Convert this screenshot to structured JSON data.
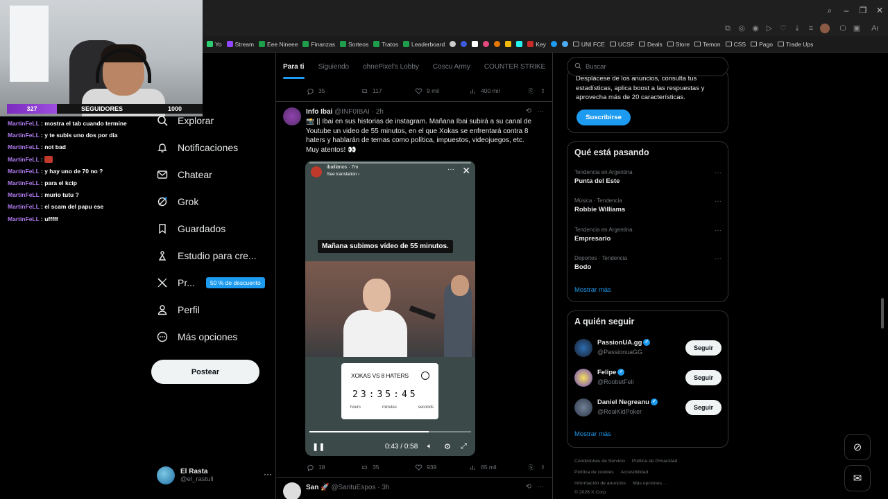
{
  "webcam": {
    "followers_count": "327",
    "followers_label": "SEGUIDORES",
    "followers_goal": "1000",
    "followers_progress": 0.327
  },
  "chat": {
    "messages": [
      {
        "user": "MartinFeLL",
        "text": " : mostra el tab cuando termine"
      },
      {
        "user": "MartinFeLL",
        "text": " : y te subis uno dos por dia"
      },
      {
        "user": "MartinFeLL",
        "text": " : not bad"
      },
      {
        "user": "MartinFeLL",
        "text": " : ",
        "emote": "red-emote"
      },
      {
        "user": "MartinFeLL",
        "text": " : y hay uno de 70 no ?"
      },
      {
        "user": "MartinFeLL",
        "text": " : para el kcip"
      },
      {
        "user": "MartinFeLL",
        "text": " : murio tutu ?"
      },
      {
        "user": "MartinFeLL",
        "text": " : el scam del papu ese"
      },
      {
        "user": "MartinFeLL",
        "text": " : ufffff"
      }
    ]
  },
  "bookmarks": [
    {
      "label": "Yo",
      "icon": "k-icon"
    },
    {
      "label": "Stream",
      "icon": "twitch-icon"
    },
    {
      "label": "Eee Nineee",
      "icon": "sheets-icon"
    },
    {
      "label": "Finanzas",
      "icon": "sheets-icon"
    },
    {
      "label": "Sorteos",
      "icon": "sheets-icon"
    },
    {
      "label": "Tratos",
      "icon": "sheets-icon"
    },
    {
      "label": "Leaderboard",
      "icon": "sheets-icon"
    },
    {
      "label": "Key",
      "icon": "key-icon"
    },
    {
      "label": "UNI FCE",
      "icon": "folder-icon"
    },
    {
      "label": "UCSF",
      "icon": "folder-icon"
    },
    {
      "label": "Deals",
      "icon": "folder-icon"
    },
    {
      "label": "Store",
      "icon": "folder-icon"
    },
    {
      "label": "Temon",
      "icon": "folder-icon"
    },
    {
      "label": "CSS",
      "icon": "folder-icon"
    },
    {
      "label": "Pago",
      "icon": "folder-icon"
    },
    {
      "label": "Trade Ups",
      "icon": "folder-icon"
    }
  ],
  "nav": {
    "explore": "Explorar",
    "notifications": "Notificaciones",
    "chat": "Chatear",
    "grok": "Grok",
    "bookmarks": "Guardados",
    "studio": "Estudio para cre...",
    "premium": "Pr...",
    "premium_badge": "50 % de descuento",
    "profile": "Perfil",
    "more": "Más opciones",
    "post_button": "Postear",
    "account_name": "El Rasta",
    "account_handle": "@el_rastull"
  },
  "feed": {
    "tabs": [
      "Para ti",
      "Siguiendo",
      "ohnePixel's Lobby",
      "Coscu Army",
      "COUNTER STRIKE"
    ],
    "prev_tweet_actions": {
      "replies": "35",
      "reposts": "117",
      "likes": "9 mil",
      "views": "400 mil"
    },
    "tweet": {
      "name": "Info Ibai",
      "handle": "@INF0IBAI",
      "time": "· 2h",
      "text": "📸 || Ibai en sus historias de instagram. Mañana Ibai subirá a su canal de Youtube un video de 55 minutos, en el que Xokas se enfrentará contra 8 haters y hablarán de temas como política, impuestos, videojuegos, etc. Muy atentos! 👀",
      "actions": {
        "replies": "18",
        "reposts": "35",
        "likes": "939",
        "views": "65 mil"
      }
    },
    "video": {
      "story_user": "ibaillanos",
      "story_time": "7m",
      "translate": "See translation ›",
      "caption": "Mañana subimos vídeo de 55 minutos.",
      "timer_title": "XOKAS VS 8 HATERS",
      "timer_digits": "23:35:45",
      "timer_labels": [
        "hours",
        "minutes",
        "seconds"
      ],
      "time": "0:43 / 0:58",
      "progress": 0.74
    },
    "next_tweet": {
      "name": "San 🚀",
      "handle": "@SantuEspos",
      "time": "· 3h"
    }
  },
  "right": {
    "search_placeholder": "Buscar",
    "premium_text": "Desplácese de los anuncios, consulta tus estadísticas, aplica boost a las respuestas y aprovecha más de 20 características.",
    "subscribe": "Suscribirse",
    "trends_title": "Qué está pasando",
    "trends": [
      {
        "category": "Tendencia en Argentina",
        "name": "Punta del Este"
      },
      {
        "category": "Música · Tendencia",
        "name": "Robbie Williams"
      },
      {
        "category": "Tendencia en Argentina",
        "name": "Empresario"
      },
      {
        "category": "Deportes · Tendencia",
        "name": "Bodo"
      }
    ],
    "show_more": "Mostrar más",
    "follow_title": "A quién seguir",
    "follow": [
      {
        "name": "PassionUA.gg",
        "handle": "@PassionuaGG",
        "button": "Seguir"
      },
      {
        "name": "Felipe",
        "handle": "@RoobetFeli",
        "button": "Seguir"
      },
      {
        "name": "Daniel Negreanu",
        "handle": "@RealKidPoker",
        "button": "Seguir"
      }
    ],
    "footer": [
      "Condiciones de Servicio",
      "Política de Privacidad",
      "Política de cookies",
      "Accesibilidad",
      "Información de anuncios",
      "Más opciones ...",
      "© 2026 X Corp."
    ]
  },
  "colors": {
    "accent": "#1d9bf0",
    "background": "#000000",
    "text": "#e7e9ea",
    "muted": "#71767b",
    "chat_user": "#b07cf0"
  }
}
